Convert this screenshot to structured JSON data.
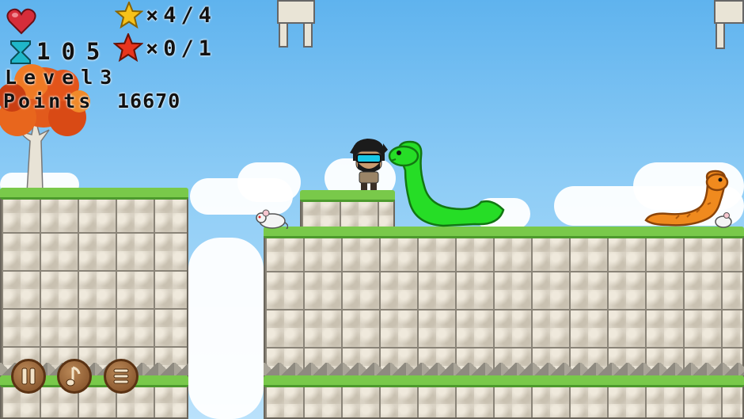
{
  "hud": {
    "stars_yellow": "×4/4",
    "timer": "105",
    "stars_red": "×0/1",
    "level_label": "Level3",
    "points_label": "Points",
    "points_value": "16670"
  },
  "icons": {
    "heart": "heart-icon",
    "hourglass": "hourglass-icon",
    "star_yellow": "star-icon",
    "star_red": "red-star-icon",
    "pause": "pause-icon",
    "music": "music-note-icon",
    "menu": "menu-icon"
  },
  "colors": {
    "sky": "#5fb3ee",
    "grass": "#79c94a",
    "snake_green": "#22d622",
    "snake_orange": "#f08a1e",
    "heart": "#d62d3a",
    "hourglass": "#1fb7c9",
    "button_wood": "#8b5a2b"
  }
}
